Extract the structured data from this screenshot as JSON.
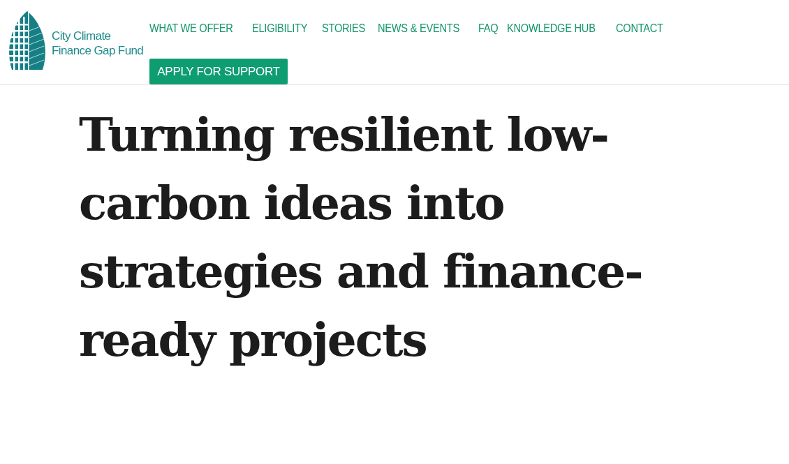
{
  "logo": {
    "lines": [
      "City Climate",
      "Finance Gap Fund"
    ]
  },
  "nav": {
    "items": [
      {
        "label": "WHAT WE OFFER"
      },
      {
        "label": "ELIGIBILITY"
      },
      {
        "label": "STORIES"
      },
      {
        "label": "NEWS & EVENTS"
      },
      {
        "label": "FAQ"
      },
      {
        "label": "KNOWLEDGE HUB"
      },
      {
        "label": "CONTACT"
      }
    ],
    "cta": "APPLY FOR SUPPORT"
  },
  "hero": {
    "title": "Turning resilient low-carbon ideas into strategies and finance-ready projects"
  }
}
